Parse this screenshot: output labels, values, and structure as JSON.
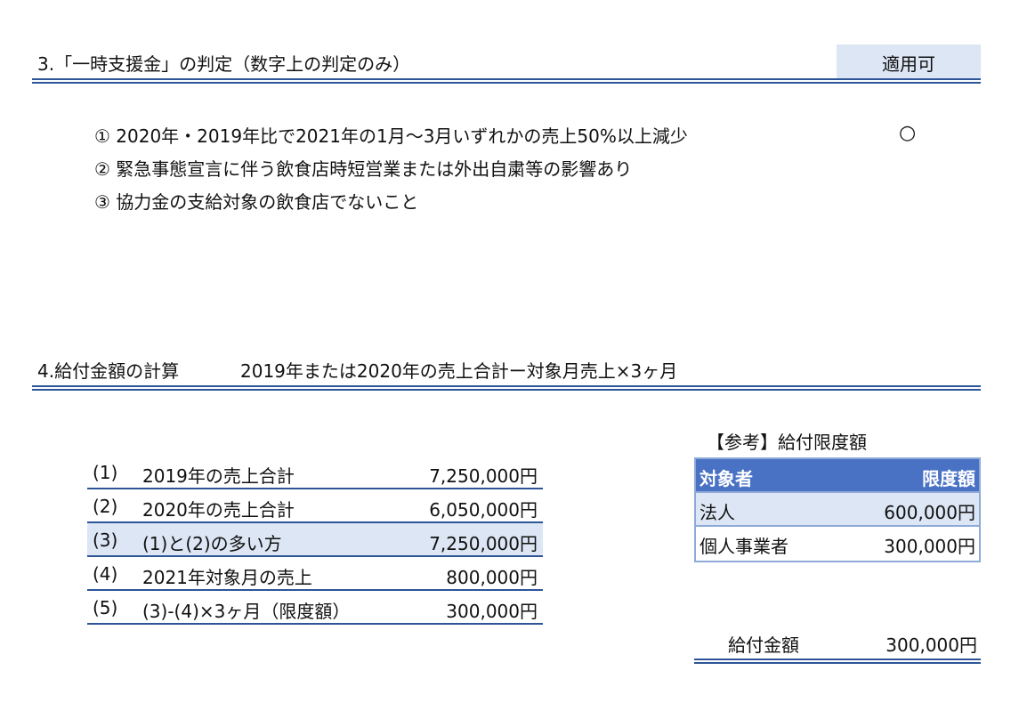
{
  "section3": {
    "title": "3.「一時支援金」の判定（数字上の判定のみ）",
    "verdict": "適用可",
    "criteria": [
      {
        "text": "① 2020年・2019年比で2021年の1月～3月いずれかの売上50%以上減少",
        "check": "○"
      },
      {
        "text": "② 緊急事態宣言に伴う飲食店時短営業または外出自粛等の影響あり"
      },
      {
        "text": "③ 協力金の支給対象の飲食店でないこと"
      }
    ]
  },
  "section4": {
    "title": "4.給付金額の計算",
    "formula": "2019年または2020年の売上合計ー対象月売上×3ヶ月",
    "rows": [
      {
        "num": "(1)",
        "label": "2019年の売上合計",
        "value": "7,250,000円"
      },
      {
        "num": "(2)",
        "label": "2020年の売上合計",
        "value": "6,050,000円"
      },
      {
        "num": "(3)",
        "label": "(1)と(2)の多い方",
        "value": "7,250,000円"
      },
      {
        "num": "(4)",
        "label": "2021年対象月の売上",
        "value": "800,000円"
      },
      {
        "num": "(5)",
        "label": "(3)-(4)×3ヶ月（限度額）",
        "value": "300,000円"
      }
    ],
    "reference": {
      "title": "【参考】給付限度額",
      "headers": [
        "対象者",
        "限度額"
      ],
      "rows": [
        {
          "who": "法人",
          "limit": "600,000円"
        },
        {
          "who": "個人事業者",
          "limit": "300,000円"
        }
      ]
    },
    "payment": {
      "label": "給付金額",
      "value": "300,000円"
    }
  },
  "colors": {
    "rule": "#2e5597",
    "highlight": "#dce6f4",
    "ref_header": "#4a72c4",
    "ref_border": "#8eaad8"
  }
}
